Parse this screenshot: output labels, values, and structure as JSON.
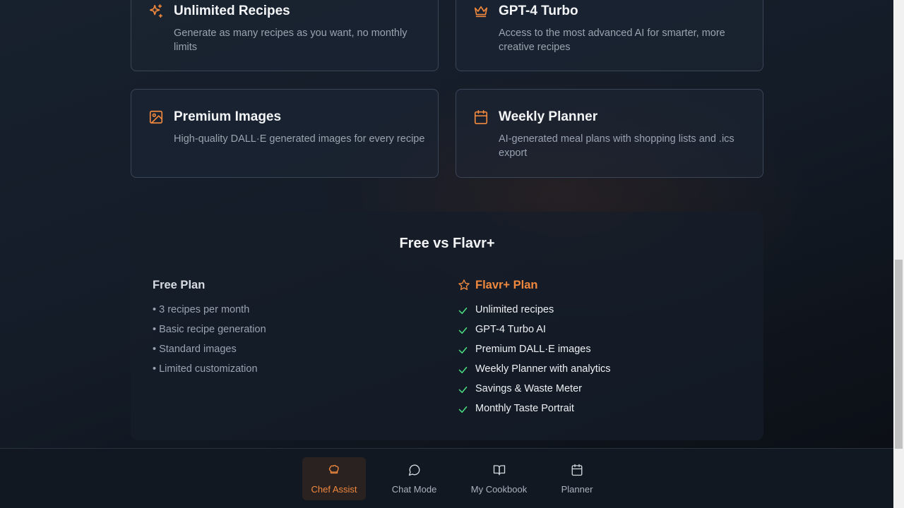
{
  "features": [
    {
      "icon": "sparkles-icon",
      "title": "Unlimited Recipes",
      "description": "Generate as many recipes as you want, no monthly limits"
    },
    {
      "icon": "crown-icon",
      "title": "GPT-4 Turbo",
      "description": "Access to the most advanced AI for smarter, more creative recipes"
    },
    {
      "icon": "image-icon",
      "title": "Premium Images",
      "description": "High-quality DALL·E generated images for every recipe"
    },
    {
      "icon": "calendar-icon",
      "title": "Weekly Planner",
      "description": "AI-generated meal plans with shopping lists and .ics export"
    }
  ],
  "comparison": {
    "title": "Free vs Flavr+",
    "free": {
      "heading": "Free Plan",
      "items": [
        "• 3 recipes per month",
        "• Basic recipe generation",
        "• Standard images",
        "• Limited customization"
      ]
    },
    "plus": {
      "heading": "Flavr+ Plan",
      "items": [
        "Unlimited recipes",
        "GPT-4 Turbo AI",
        "Premium DALL·E images",
        "Weekly Planner with analytics",
        "Savings & Waste Meter",
        "Monthly Taste Portrait"
      ]
    }
  },
  "nav": {
    "items": [
      {
        "label": "Chef Assist",
        "icon": "chef-hat-icon",
        "active": true
      },
      {
        "label": "Chat Mode",
        "icon": "chat-bubble-icon",
        "active": false
      },
      {
        "label": "My Cookbook",
        "icon": "book-open-icon",
        "active": false
      },
      {
        "label": "Planner",
        "icon": "calendar-icon",
        "active": false
      }
    ]
  },
  "colors": {
    "accent": "#f0883e",
    "check": "#4ade80",
    "muted_text": "#9aa3b0"
  }
}
